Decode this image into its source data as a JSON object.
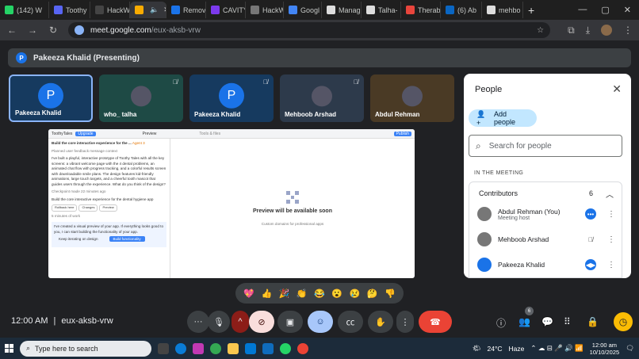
{
  "browser": {
    "tabs": [
      {
        "label": "(142) W",
        "color": "#25d366"
      },
      {
        "label": "Toothy",
        "color": "#5865f2"
      },
      {
        "label": "HackW",
        "color": "#444"
      },
      {
        "label": "",
        "color": "#f9ab00",
        "active": true
      },
      {
        "label": "Remov",
        "color": "#1a73e8"
      },
      {
        "label": "CAVITY",
        "color": "#7c3aed"
      },
      {
        "label": "HackW",
        "color": "#777"
      },
      {
        "label": "Googl",
        "color": "#4285f4"
      },
      {
        "label": "Manag",
        "color": "#ddd"
      },
      {
        "label": "Talha-",
        "color": "#ddd"
      },
      {
        "label": "Therab",
        "color": "#e8453c"
      },
      {
        "label": "(6) Ab",
        "color": "#0a66c2"
      },
      {
        "label": "mehbo",
        "color": "#ddd"
      }
    ],
    "url_host": "meet.google.com",
    "url_path": "/eux-aksb-vrw"
  },
  "meet": {
    "presenting_initial": "P",
    "presenting_label": "Pakeeza Khalid (Presenting)",
    "tiles": [
      {
        "name": "Pakeeza Khalid",
        "initial": "P",
        "bg": "#163a5f",
        "muted": false
      },
      {
        "name": "who_ talha",
        "initial": "",
        "bg": "#1e4a45",
        "muted": true
      },
      {
        "name": "Pakeeza Khalid",
        "initial": "P",
        "bg": "#163a5f",
        "muted": true
      },
      {
        "name": "Mehboob Arshad",
        "initial": "",
        "bg": "#2d3a4b",
        "muted": true
      },
      {
        "name": "Abdul Rehman",
        "initial": "",
        "bg": "#4a3a25",
        "muted": false
      }
    ],
    "shared_screen": {
      "app_name": "ToothyTales",
      "upgrade": "Upgrade",
      "task_title": "Build the core interactive experience for the ...",
      "agent_badge": "Agent 3",
      "planned": "Planned user feedback message context",
      "body": "I've built a playful, interactive prototype of Toothy Tales with all the key screens: a vibrant welcome page with the 4 dental problems, an animated chat flow with progress tracking, and a colorful results screen with downloadable smile plans. The design features kid-friendly animations, large touch targets, and a cheerful tooth mascot that guides users through the experience. What do you think of the design?",
      "checkpoint": "Checkpoint made 22 minutes ago",
      "checkpoint_task": "Build the core interactive experience for the dental hygiene app",
      "chips": [
        "Rollback here",
        "Changes",
        "Preview"
      ],
      "worked": "5 minutes of work",
      "message": "I've created a visual preview of your app. If everything looks good to you, I can start building the functionality of your app.",
      "keep": "Keep iterating on design",
      "build": "Build functionality",
      "preview_tab": "Preview",
      "tools_tab": "Tools & files",
      "publish": "Publish",
      "preview_title": "Preview will be available soon",
      "preview_sub": "Custom domains for professional apps"
    },
    "people_panel": {
      "title": "People",
      "add_people": "Add people",
      "search_placeholder": "Search for people",
      "section": "IN THE MEETING",
      "contributors_label": "Contributors",
      "contributors_count": "6",
      "people": [
        {
          "name": "Abdul Rehman (You)",
          "sub": "Meeting host",
          "status_color": "#1a73e8"
        },
        {
          "name": "Mehboob Arshad",
          "sub": "",
          "status_color": ""
        },
        {
          "name": "Pakeeza Khalid",
          "sub": "",
          "status_color": "#1a73e8"
        }
      ]
    },
    "reactions": [
      "💖",
      "👍",
      "🎉",
      "👏",
      "😂",
      "😮",
      "😢",
      "🤔",
      "👎"
    ],
    "time": "12:00 AM",
    "separator": "|",
    "meeting_code": "eux-aksb-vrw",
    "people_count_badge": "6"
  },
  "taskbar": {
    "search_placeholder": "Type here to search",
    "weather": "24°C",
    "weather_desc": "Haze",
    "time": "12:00 am",
    "date": "10/10/2025"
  }
}
